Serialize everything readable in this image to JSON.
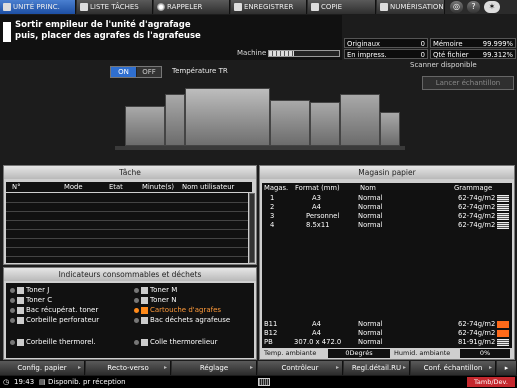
{
  "tabs": [
    {
      "label": "UNITÉ PRINC.",
      "icon": "printer-icon"
    },
    {
      "label": "LISTE TÂCHES",
      "icon": "list-icon"
    },
    {
      "label": "RAPPELER",
      "icon": "recall-icon"
    },
    {
      "label": "ENREGISTRER",
      "icon": "save-icon"
    },
    {
      "label": "COPIE",
      "icon": "copy-icon"
    },
    {
      "label": "NUMÉRISATION",
      "icon": "scan-icon"
    }
  ],
  "message": {
    "line1": "Sortir empileur de l'unité d'agrafage",
    "line2": "puis, placer des agrafes ds l'agrafeuse"
  },
  "machine_label": "Machine",
  "machine_progress": 0.35,
  "counters": [
    {
      "label": "Originaux",
      "value": "0"
    },
    {
      "label": "Mémoire",
      "value": "99.999%"
    },
    {
      "label": "En impress.",
      "value": "0"
    },
    {
      "label": "Qté fichier",
      "value": "99.312%"
    }
  ],
  "scanner_status": "Scanner disponible",
  "lancer_label": "Lancer échantillon",
  "temp_toggle": {
    "on": "ON",
    "off": "OFF",
    "label": "Température TR"
  },
  "tache": {
    "title": "Tâche",
    "headers": [
      "N°",
      "Mode",
      "Etat",
      "Minute(s)",
      "Nom utilisateur"
    ]
  },
  "indicateurs": {
    "title": "Indicateurs consommables et déchets",
    "items": [
      {
        "label": "Toner J",
        "warn": false
      },
      {
        "label": "Toner M",
        "warn": false
      },
      {
        "label": "Toner C",
        "warn": false
      },
      {
        "label": "Toner N",
        "warn": false
      },
      {
        "label": "Bac récupérat. toner",
        "warn": false
      },
      {
        "label": "Cartouche d'agrafes",
        "warn": true
      },
      {
        "label": "Corbeille perforateur",
        "warn": false
      },
      {
        "label": "Bac déchets agrafeuse",
        "warn": false
      },
      {
        "label": "Corbeille thermorel.",
        "warn": false
      },
      {
        "label": "Colle thermorelieur",
        "warn": false
      }
    ]
  },
  "magasin": {
    "title": "Magasin papier",
    "headers": [
      "Magas.",
      "Format (mm)",
      "Nom",
      "Grammage"
    ],
    "rows": [
      {
        "mag": "1",
        "format": "A3",
        "nom": "Normal",
        "grammage": "62-74g/m2",
        "level": "full"
      },
      {
        "mag": "2",
        "format": "A4",
        "nom": "Normal",
        "grammage": "62-74g/m2",
        "level": "full"
      },
      {
        "mag": "3",
        "format": "Personnel",
        "nom": "Normal",
        "grammage": "62-74g/m2",
        "level": "full"
      },
      {
        "mag": "4",
        "format": "8.5x11",
        "nom": "Normal",
        "grammage": "62-74g/m2",
        "level": "full"
      },
      {
        "mag": "B11",
        "format": "A4",
        "nom": "Normal",
        "grammage": "62-74g/m2",
        "level": "low"
      },
      {
        "mag": "B12",
        "format": "A4",
        "nom": "Normal",
        "grammage": "62-74g/m2",
        "level": "low"
      },
      {
        "mag": "PB",
        "format": "307.0 x 472.0",
        "nom": "Normal",
        "grammage": "81-91g/m2",
        "level": "full"
      }
    ],
    "temp_label": "Temp. ambiante",
    "temp_value": "0Degrés",
    "humid_label": "Humid. ambiante",
    "humid_value": "0%"
  },
  "bottom_buttons": [
    "Config. papier",
    "Recto-verso",
    "Réglage",
    "Contrôleur",
    "Regl.détail.RU",
    "Conf. échantillon"
  ],
  "status": {
    "time": "19:43",
    "text": "Disponib. pr réception",
    "badge": "Tamb/Dev."
  }
}
